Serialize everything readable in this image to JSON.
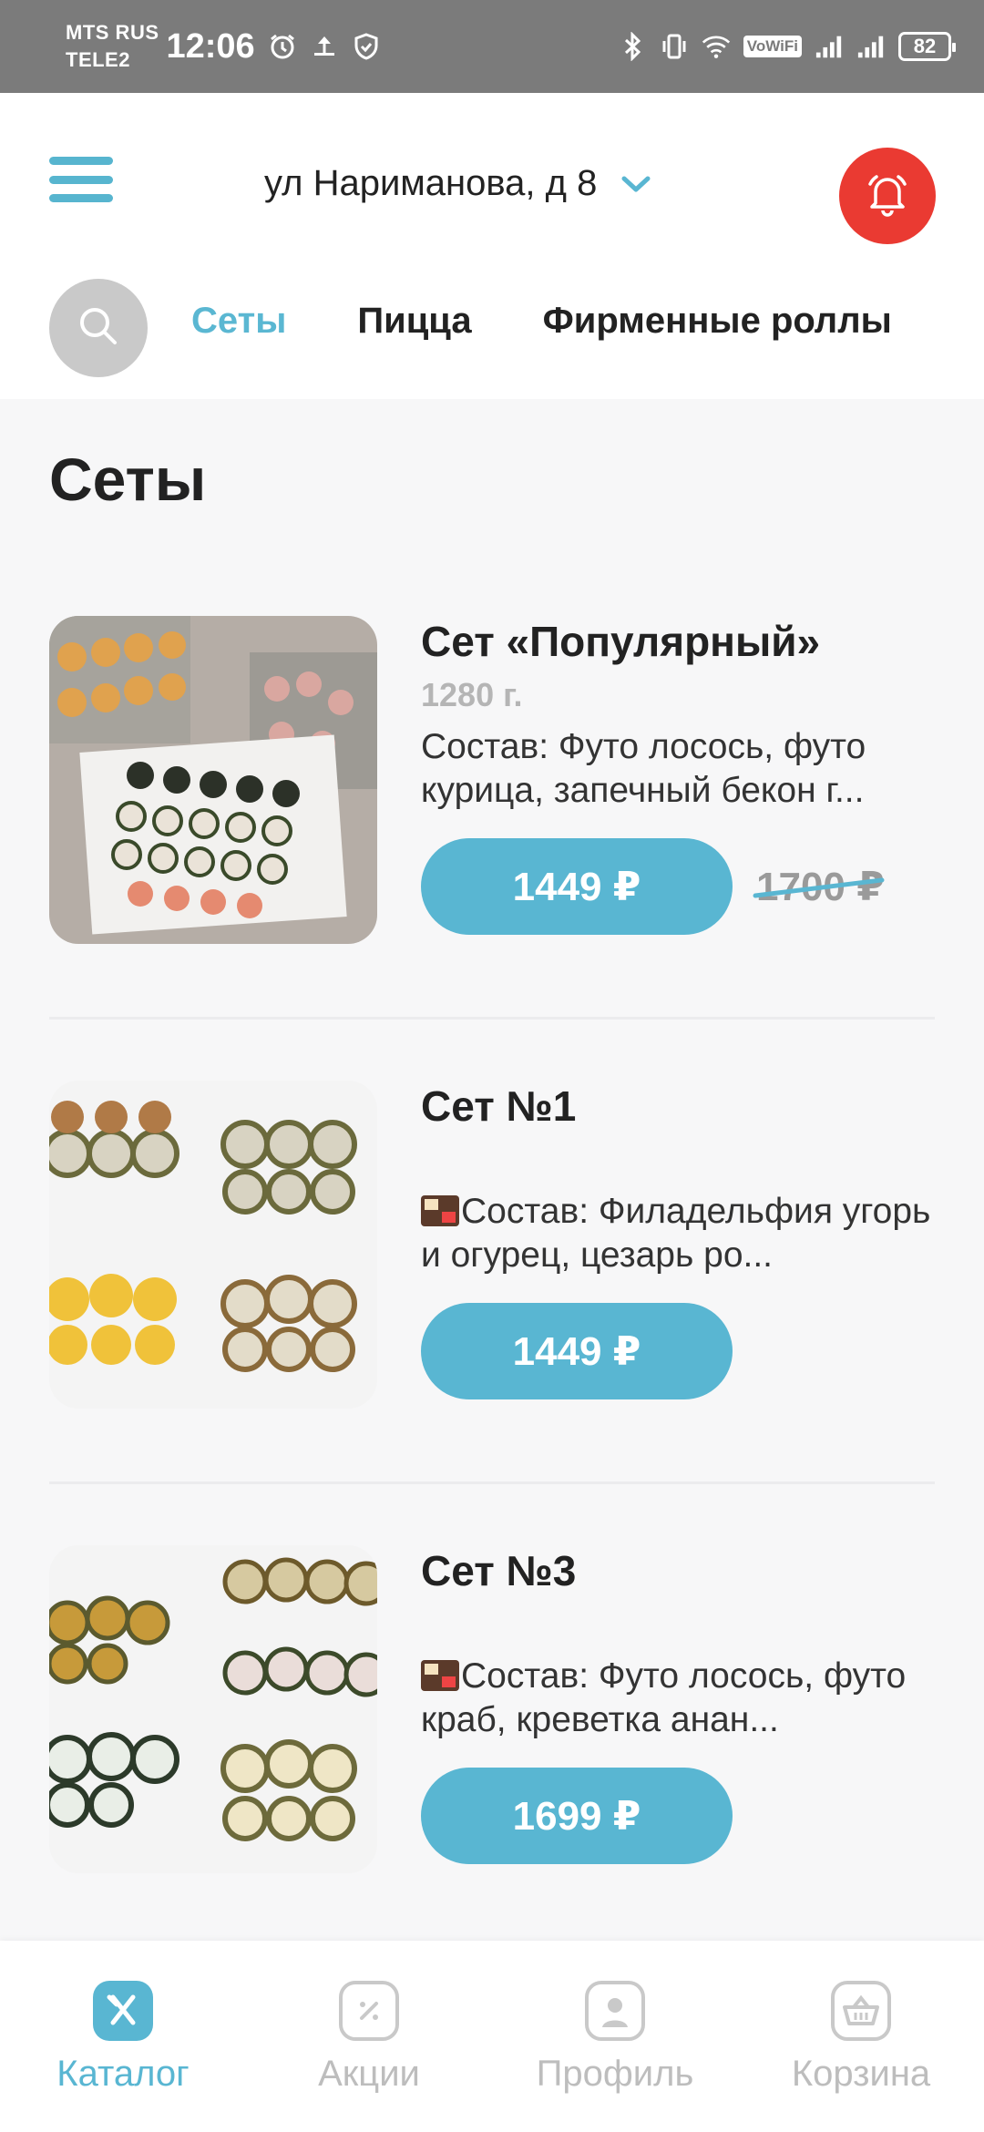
{
  "status_bar": {
    "carrier_1": "MTS RUS",
    "carrier_2": "TELE2",
    "time": "12:06",
    "vowifi": "VoWiFi",
    "battery": "82"
  },
  "header": {
    "address": "ул Нариманова, д 8",
    "tabs": [
      {
        "label": "Сеты",
        "active": true
      },
      {
        "label": "Пицца",
        "active": false
      },
      {
        "label": "Фирменные роллы",
        "active": false
      }
    ]
  },
  "section": {
    "title": "Сеты"
  },
  "products": [
    {
      "name": "Сет «Популярный»",
      "weight": "1280 г.",
      "description": "Состав: Футо лосось, футо курица, запечный бекон г...",
      "price": "1449 ₽",
      "old_price": "1700 ₽"
    },
    {
      "name": "Сет №1",
      "weight": "",
      "description": "Состав: Филадельфия угорь и огурец, цезарь ро...",
      "price": "1449 ₽",
      "old_price": ""
    },
    {
      "name": "Сет №3",
      "weight": "",
      "description": "Состав: Футо лосось, футо краб, креветка анан...",
      "price": "1699 ₽",
      "old_price": ""
    }
  ],
  "bottom_nav": [
    {
      "label": "Каталог",
      "icon": "catalog-icon",
      "active": true
    },
    {
      "label": "Акции",
      "icon": "promo-icon",
      "active": false
    },
    {
      "label": "Профиль",
      "icon": "profile-icon",
      "active": false
    },
    {
      "label": "Корзина",
      "icon": "basket-icon",
      "active": false
    }
  ],
  "colors": {
    "accent": "#59b6d2",
    "bell": "#ea3a32",
    "status_bar": "#7b7b7b"
  }
}
